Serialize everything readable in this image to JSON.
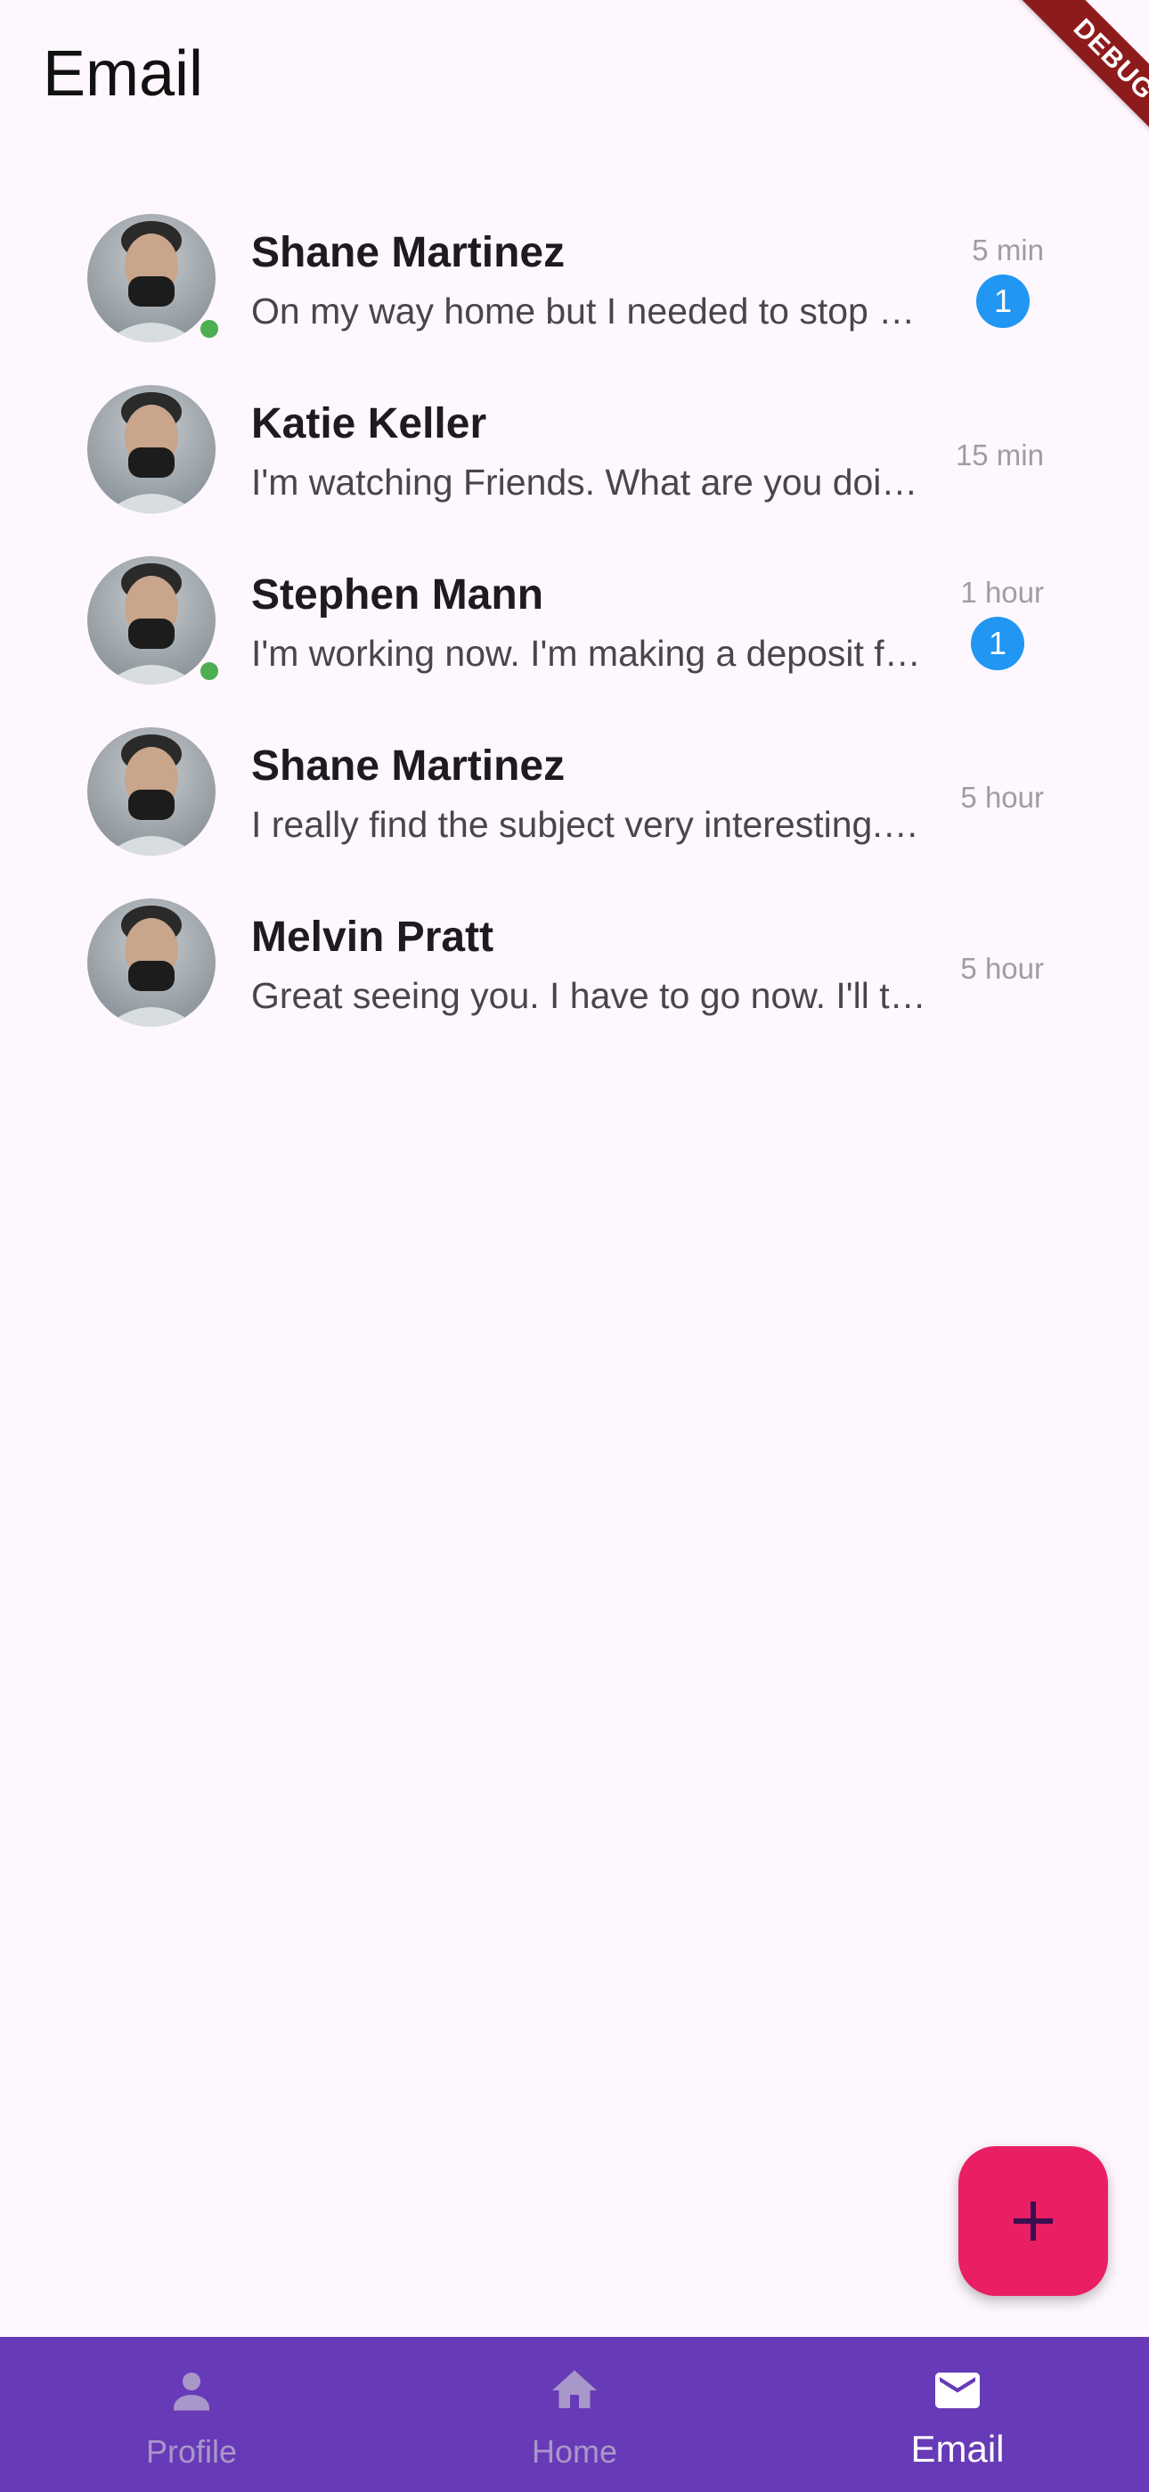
{
  "app_bar": {
    "title": "Email",
    "debug_label": "DEBUG"
  },
  "conversations": [
    {
      "name": "Shane Martinez",
      "preview": "On my way home but I needed to stop by the book store to pick up a few things.",
      "time": "5 min",
      "unread": "1",
      "online": true
    },
    {
      "name": "Katie Keller",
      "preview": "I'm watching Friends. What are you doing?",
      "time": "15 min",
      "unread": null,
      "online": false
    },
    {
      "name": "Stephen Mann",
      "preview": "I'm working now. I'm making a deposit for our company.",
      "time": "1 hour",
      "unread": "1",
      "online": true
    },
    {
      "name": "Shane Martinez",
      "preview": "I really find the subject very interesting. I'm enjoying all my classes.",
      "time": "5 hour",
      "unread": null,
      "online": false
    },
    {
      "name": "Melvin Pratt",
      "preview": "Great seeing you. I have to go now. I'll talk to you later.",
      "time": "5 hour",
      "unread": null,
      "online": false
    }
  ],
  "fab": {
    "icon": "plus-icon"
  },
  "bottom_nav": {
    "items": [
      {
        "label": "Profile",
        "icon": "person-icon",
        "active": false
      },
      {
        "label": "Home",
        "icon": "home-icon",
        "active": false
      },
      {
        "label": "Email",
        "icon": "mail-icon",
        "active": true
      }
    ]
  },
  "colors": {
    "background": "#fef7fe",
    "nav_background": "#673ab7",
    "fab": "#e91e63",
    "badge": "#2196f3",
    "online": "#4caf50"
  }
}
